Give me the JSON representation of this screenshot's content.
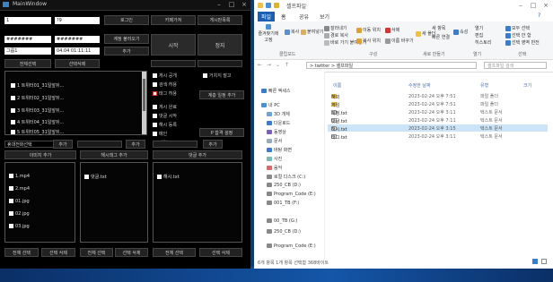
{
  "app": {
    "title": "MainWindow",
    "fields": {
      "id1": "1",
      "id2": "?9",
      "pw1": "#######",
      "pw2": "#######",
      "group": "그룹1",
      "date": "04.04 01:11:11",
      "tag_input": "",
      "tag_list_field": "",
      "ext_field": "",
      "search_field": "",
      "keyword1": "",
      "keyword2": ""
    },
    "buttons": {
      "login": "로그인",
      "get_cafe": "카페가져",
      "get_board": "게시판목록",
      "load_account": "계정 불러오기",
      "add": "추가",
      "start": "시작",
      "stop": "정지",
      "select_all": "전체선택",
      "delete_selected": "선택삭제",
      "write_post": "계층 일정 추가",
      "add_phone": "추가",
      "add_tag": "추가",
      "add_file": "추가",
      "p_setting": "P 합격 설정",
      "image_add": "이미지 추가",
      "rehash_add": "해시태그 추가",
      "comment_add": "댓글 추가",
      "all_select_1": "전체 선택",
      "sel_delete_1": "선택 삭제",
      "all_select_2": "전체 선택",
      "sel_delete_2": "선택 삭제",
      "all_select_3": "전체 선택",
      "sel_delete_3": "선택 삭제"
    },
    "checks": [
      "게시 공개",
      "검색 허용",
      "태그 허용",
      "게시 완료",
      "댓글 시작",
      "해시 등록",
      "메인",
      "작업"
    ],
    "check_side": [
      "거치지 말고"
    ],
    "tasks": [
      "1 트위터01_31일앞뒤...",
      "2 트위터02_31일앞뒤...",
      "3 트위터03_31일앞뒤...",
      "4 트위터04_31일앞뒤...",
      "5 트위터05_31일앞뒤..."
    ],
    "phone_label": "휴대전화선택",
    "files_col1": [
      "1.mp4",
      "2.mp4",
      "01.jpg",
      "02.jpg",
      "03.jpg"
    ],
    "files_col2": [
      "댓글.txt"
    ],
    "files_col3": [
      "해시.txt"
    ]
  },
  "explorer": {
    "title": "셀프파일",
    "tabs": [
      "파일",
      "홈",
      "공유",
      "보기"
    ],
    "ribbon": {
      "pin": "즐겨찾기에 고정",
      "copy": "복사",
      "paste": "붙여넣기",
      "cut": "잘라내기",
      "copy_path": "경로 복사",
      "paste_shortcut": "바로 가기 붙여넣기",
      "move_to": "이동 위치",
      "copy_to": "복사 위치",
      "delete": "삭제",
      "rename": "이름 바꾸기",
      "new_folder": "새 폴더",
      "new_item": "새 항목",
      "easy_access": "빠른 연결",
      "properties": "속성",
      "open": "열기",
      "edit": "편집",
      "history": "히스토리",
      "select_all": "모두 선택",
      "select_none": "선택 안 함",
      "invert": "선택 영역 반전",
      "group_clipboard": "클립보드",
      "group_organize": "구성",
      "group_new": "새로 만들기",
      "group_open": "열기",
      "group_select": "선택"
    },
    "path": "> twitter > 셀프파일",
    "search_placeholder": "셀프파일 검색",
    "columns": {
      "name": "이름",
      "date": "수정한 날짜",
      "type": "유형",
      "size": "크기"
    },
    "files": [
      {
        "name": "해외",
        "date": "2023-02-24 오후 7:51",
        "type": "파일 폴더",
        "size": ""
      },
      {
        "name": "게임",
        "date": "2023-02-24 오후 7:51",
        "type": "파일 폴더",
        "size": ""
      },
      {
        "name": "계정.txt",
        "date": "2023-02-24 오후 3:11",
        "type": "텍스트 문서",
        "size": ""
      },
      {
        "name": "댓글.txt",
        "date": "2023-02-24 오후 7:11",
        "type": "텍스트 문서",
        "size": ""
      },
      {
        "name": "해시.txt",
        "date": "2023-02-24 오후 3:15",
        "type": "텍스트 문서",
        "size": ""
      },
      {
        "name": "태그.txt",
        "date": "2023-02-24 오후 3:11",
        "type": "텍스트 문서",
        "size": ""
      }
    ],
    "nav": [
      "빠른 액세스",
      "내 PC",
      "3D 개체",
      "다운로드",
      "동영상",
      "문서",
      "바탕 화면",
      "사진",
      "음악",
      "로컬 디스크 (C:)",
      "250_CB (D:)",
      "Program_Code (E:)",
      "001_TB (F:)",
      "00_TB (G:)",
      "250_CB (D:)",
      "Program_Code (E:)"
    ],
    "status": "6개 항목  1개 항목 선택함 368바이트"
  }
}
